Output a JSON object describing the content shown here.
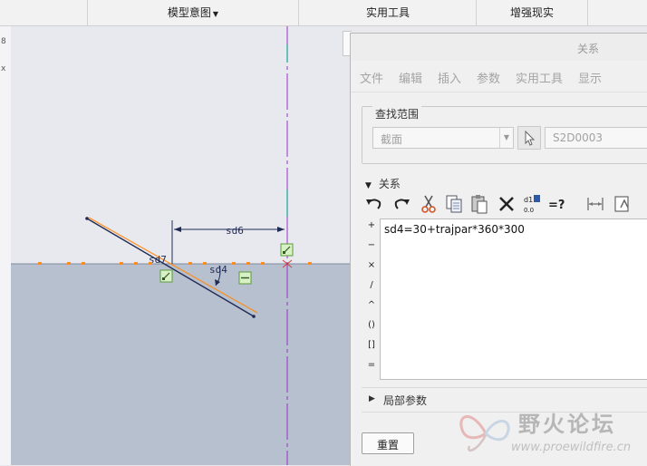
{
  "ribbon": {
    "tabs": [
      "模型意图",
      "实用工具",
      "增强现实"
    ]
  },
  "left_strip": {
    "labels": [
      "8",
      "x"
    ]
  },
  "sketch": {
    "dimensions": [
      "sd6",
      "sd7",
      "sd4"
    ]
  },
  "dialog": {
    "title": "关系",
    "menu": [
      "文件",
      "编辑",
      "插入",
      "参数",
      "实用工具",
      "显示"
    ],
    "scope": {
      "label": "查找范围",
      "type_value": "截面",
      "feature_value": "S2D0003"
    },
    "relations_label": "关系",
    "toolbar_icons": [
      "undo-icon",
      "redo-icon",
      "cut-icon",
      "copy-icon",
      "paste-icon",
      "delete-icon",
      "value-toggle-icon",
      "evaluate-icon",
      "measure-icon",
      "sort-icon"
    ],
    "toolbar_texts": {
      "value_toggle": "d1",
      "value_sub": "0.0",
      "evaluate": "=?"
    },
    "operators": [
      "+",
      "−",
      "×",
      "/",
      "^",
      "()",
      "[]",
      "="
    ],
    "relation_text": "sd4=30+trajpar*360*300",
    "local_params_label": "局部参数",
    "reset_label": "重置"
  },
  "watermark": {
    "title": "野火论坛",
    "url": "www.proewildfire.cn"
  },
  "colors": {
    "centerline": "#9b30c9",
    "sketch_orange": "#ff8c1a",
    "lower_region": "#b6c0ce"
  }
}
